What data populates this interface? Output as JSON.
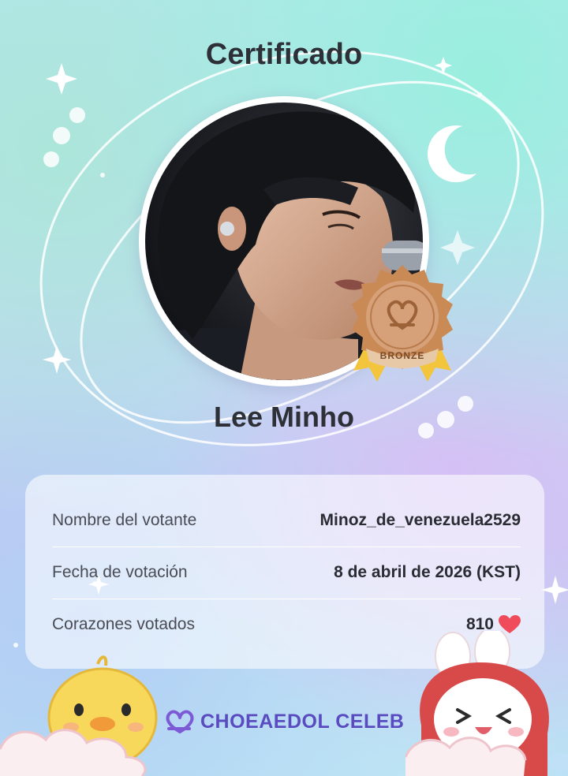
{
  "certificate": {
    "title": "Certificado",
    "celebrity_name": "Lee Minho",
    "badge_label": "BRONZE",
    "badge_color": "#c98a56"
  },
  "details": [
    {
      "label": "Nombre del votante",
      "value": "Minoz_de_venezuela2529"
    },
    {
      "label": "Fecha de votación",
      "value": "8 de abril de 2026 (KST)"
    },
    {
      "label": "Corazones votados",
      "value": "810",
      "icon": "heart-icon"
    }
  ],
  "footer": {
    "brand": "CHOEAEDOL CELEB",
    "brand_color": "#5a4bc0"
  },
  "colors": {
    "heart": "#ef4b5a",
    "text_dark": "#2e3038"
  }
}
